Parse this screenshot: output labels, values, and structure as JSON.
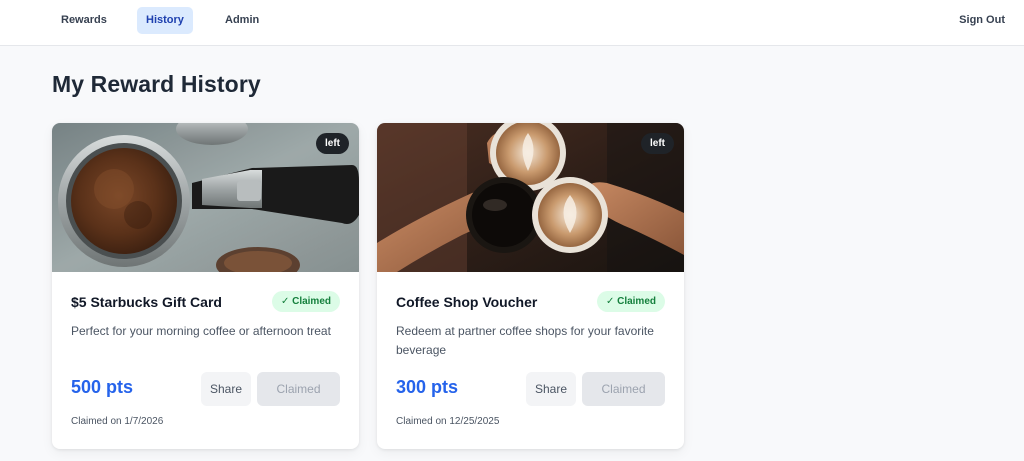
{
  "nav": {
    "items": [
      {
        "label": "Rewards"
      },
      {
        "label": "History"
      },
      {
        "label": "Admin"
      }
    ],
    "sign_out": "Sign Out"
  },
  "page": {
    "title": "My Reward History"
  },
  "rewards": [
    {
      "image_label": "left",
      "title": "$5 Starbucks Gift Card",
      "status": "✓ Claimed",
      "description": "Perfect for your morning coffee or afternoon treat",
      "points": "500 pts",
      "share_label": "Share",
      "claimed_label": "Claimed",
      "claimed_on": "Claimed on 1/7/2026"
    },
    {
      "image_label": "left",
      "title": "Coffee Shop Voucher",
      "status": "✓ Claimed",
      "description": "Redeem at partner coffee shops for your favorite beverage",
      "points": "300 pts",
      "share_label": "Share",
      "claimed_label": "Claimed",
      "claimed_on": "Claimed on 12/25/2025"
    }
  ],
  "colors": {
    "accent": "#2563eb",
    "active_nav_bg": "#dbeafe",
    "success_bg": "#dcfce7",
    "success_text": "#15803d"
  }
}
